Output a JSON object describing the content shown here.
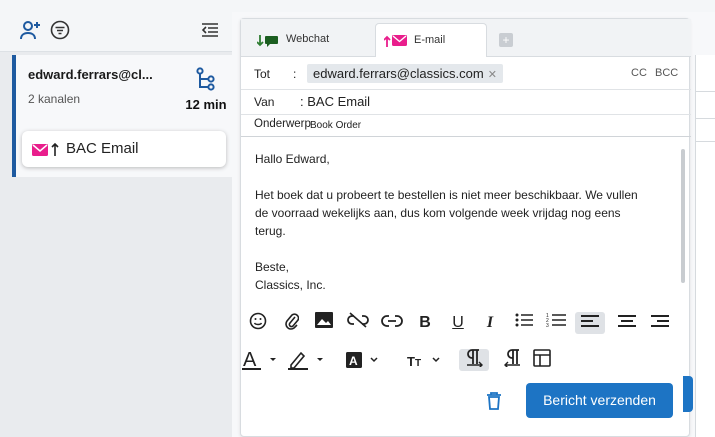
{
  "left": {
    "icons": [
      "add-user-icon",
      "filter-icon",
      "collapse-list-icon"
    ],
    "conversation": {
      "name": "edward.ferrars@cl...",
      "subtitle": "2 kanalen",
      "time": "12 min",
      "icon": "branch-icon"
    },
    "channel": {
      "label": "BAC Email",
      "icons": [
        "envelope-icon",
        "arrow-up-icon"
      ]
    }
  },
  "tabs": [
    {
      "label": "Webchat",
      "icon": "chat-incoming-icon"
    },
    {
      "label": "E-mail",
      "icon": "envelope-outgoing-icon"
    }
  ],
  "email": {
    "to_label": "Tot",
    "to_sep": ":",
    "to_value": "edward.ferrars@classics.com",
    "cc": "CC",
    "bcc": "BCC",
    "from_label": "Van",
    "from_value": ": BAC Email",
    "subject_label": "Onderwerp",
    "subject_value": "Book Order",
    "body": [
      "Hallo Edward,",
      "",
      "Het boek dat u probeert te bestellen is niet meer beschikbaar. We vullen",
      "de voorraad wekelijks aan, dus kom volgende week vrijdag nog eens",
      "terug.",
      "",
      "Beste,",
      "Classics, Inc."
    ]
  },
  "toolbar": {
    "row1": [
      "emoji-icon",
      "attach-icon",
      "image-icon",
      "unlink-icon",
      "link-icon",
      "bold-icon",
      "underline-icon",
      "italic-icon",
      "bullet-list-icon",
      "numbered-list-icon",
      "align-left-icon",
      "align-center-icon",
      "align-right-icon"
    ],
    "row2": [
      "font-color-icon",
      "highlight-icon",
      "text-background-icon",
      "font-size-icon",
      "ltr-icon",
      "rtl-icon",
      "table-icon"
    ]
  },
  "actions": {
    "send_label": "Bericht verzenden",
    "delete_icon": "trash-icon"
  },
  "colors": {
    "accent": "#1d74c4",
    "email_pink": "#e91e8c",
    "webchat_green": "#2e7d32"
  }
}
